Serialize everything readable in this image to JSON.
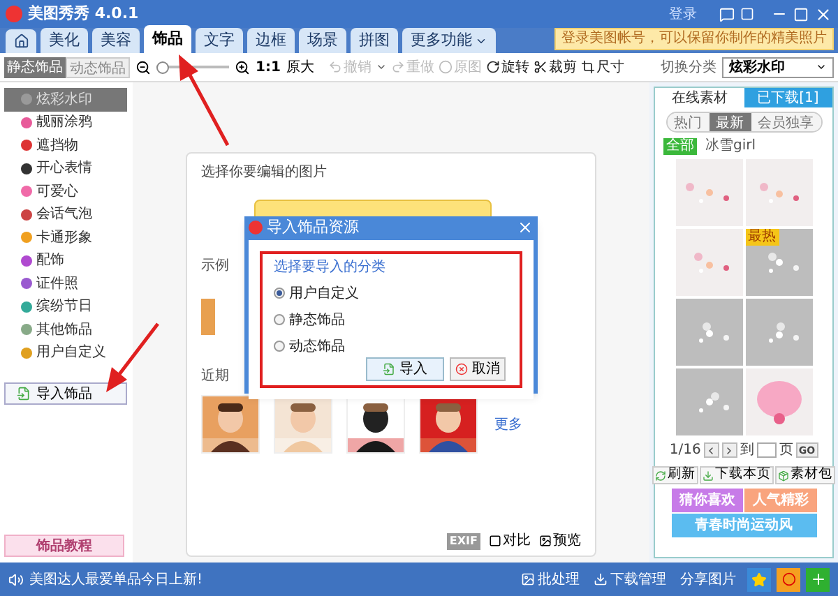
{
  "window": {
    "title": "美图秀秀 4.0.1",
    "login": "登录",
    "login_tip": "登录美图帐号，可以保留你制作的精美照片"
  },
  "tabs": [
    {
      "label": "美化",
      "selected": false,
      "kind": "text"
    },
    {
      "label": "美容",
      "selected": false,
      "kind": "text"
    },
    {
      "label": "饰品",
      "selected": true,
      "kind": "text"
    },
    {
      "label": "文字",
      "selected": false,
      "kind": "text"
    },
    {
      "label": "边框",
      "selected": false,
      "kind": "text"
    },
    {
      "label": "场景",
      "selected": false,
      "kind": "text"
    },
    {
      "label": "拼图",
      "selected": false,
      "kind": "text"
    },
    {
      "label": "更多功能",
      "selected": false,
      "kind": "menu"
    }
  ],
  "toolbar": {
    "modes": [
      {
        "label": "静态饰品",
        "selected": true
      },
      {
        "label": "动态饰品",
        "selected": false
      }
    ],
    "zoom": {
      "level": 0
    },
    "ratio": "1:1",
    "actual_size": "原大",
    "actions": [
      {
        "label": "撤销",
        "disabled": true,
        "menu": true
      },
      {
        "label": "重做",
        "disabled": true,
        "menu": false
      },
      {
        "label": "原图",
        "disabled": true,
        "menu": false
      },
      {
        "label": "旋转",
        "disabled": false,
        "menu": false
      },
      {
        "label": "裁剪",
        "disabled": false,
        "menu": false
      },
      {
        "label": "尺寸",
        "disabled": false,
        "menu": false
      }
    ],
    "category_label": "切换分类",
    "category": "炫彩水印"
  },
  "sidebar": {
    "items": [
      {
        "label": "炫彩水印",
        "selected": true
      },
      {
        "label": "靓丽涂鸦",
        "selected": false
      },
      {
        "label": "遮挡物",
        "selected": false
      },
      {
        "label": "开心表情",
        "selected": false
      },
      {
        "label": "可爱心",
        "selected": false
      },
      {
        "label": "会话气泡",
        "selected": false
      },
      {
        "label": "卡通形象",
        "selected": false
      },
      {
        "label": "配饰",
        "selected": false
      },
      {
        "label": "证件照",
        "selected": false
      },
      {
        "label": "缤纷节日",
        "selected": false
      },
      {
        "label": "其他饰品",
        "selected": false
      },
      {
        "label": "用户自定义",
        "selected": false
      }
    ],
    "import_button": "导入饰品",
    "tutorial": "饰品教程"
  },
  "canvas": {
    "prompt": "选择你要编辑的图片",
    "samples_label": "示例",
    "recent_label": "近期",
    "recent": [
      {
        "kind": "picture"
      },
      {
        "kind": "picture"
      },
      {
        "kind": "picture"
      },
      {
        "kind": "picture"
      }
    ],
    "more": "更多",
    "exif": "EXIF",
    "compare": "对比",
    "preview": "预览"
  },
  "dialog": {
    "title": "导入饰品资源",
    "heading": "选择要导入的分类",
    "options": [
      {
        "label": "用户自定义",
        "selected": true
      },
      {
        "label": "静态饰品",
        "selected": false
      },
      {
        "label": "动态饰品",
        "selected": false
      }
    ],
    "buttons": [
      "导入",
      "取消"
    ]
  },
  "right_panel": {
    "tabs": [
      {
        "label": "在线素材",
        "selected": true
      },
      {
        "label": "已下载[1]",
        "selected": false
      }
    ],
    "filters": [
      {
        "label": "热门",
        "selected": false
      },
      {
        "label": "最新",
        "selected": true
      },
      {
        "label": "会员独享",
        "selected": false
      }
    ],
    "tag": "全部",
    "author": "冰雪girl",
    "thumbs": [
      {
        "kind": "picture"
      },
      {
        "kind": "picture"
      },
      {
        "kind": "picture"
      },
      {
        "kind": "picture",
        "badge": "最热"
      },
      {
        "kind": "picture"
      },
      {
        "kind": "picture"
      },
      {
        "kind": "picture"
      },
      {
        "kind": "picture"
      }
    ],
    "pager": {
      "page": "1/16",
      "goto": "到",
      "unit": "页",
      "go": "GO"
    },
    "buttons": [
      "刷新",
      "下载本页",
      "素材包"
    ],
    "banners": [
      {
        "label": "猜你喜欢",
        "color": "#c77be8"
      },
      {
        "label": "人气精彩",
        "color": "#f9a47e"
      },
      {
        "label": "青春时尚运动风",
        "color": "#5bbcf0"
      }
    ]
  },
  "status": {
    "news": "美图达人最爱单品今日上新!",
    "actions": [
      "批处理",
      "下载管理",
      "分享图片"
    ]
  }
}
